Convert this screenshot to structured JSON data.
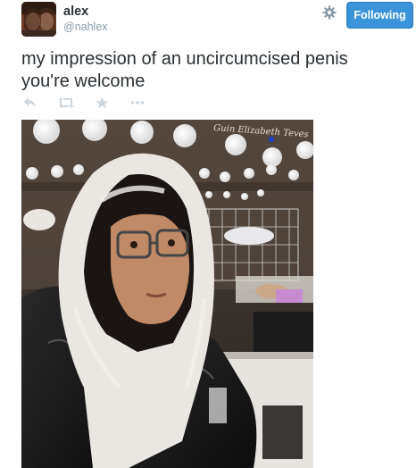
{
  "tweet": {
    "author": {
      "display_name": "alex",
      "screen_name": "@nahlex",
      "avatar_icon": "profile-photo"
    },
    "settings_icon": "gear-icon",
    "follow_button_label": "Following",
    "text_line_1": "my impression of an uncircumcised penis",
    "text_line_2": "you're welcome",
    "actions": {
      "reply_icon": "reply-icon",
      "retweet_icon": "retweet-icon",
      "favorite_icon": "star-icon",
      "more_icon": "more-icon"
    },
    "photo": {
      "description_icon": "attached-photo",
      "wall_lettering": "Guin Elizabeth Teves"
    }
  },
  "colors": {
    "follow_button_bg": "#3b94d9",
    "text": "#292f33",
    "muted": "#8899a6",
    "action_icons": "#ccd6dd"
  }
}
